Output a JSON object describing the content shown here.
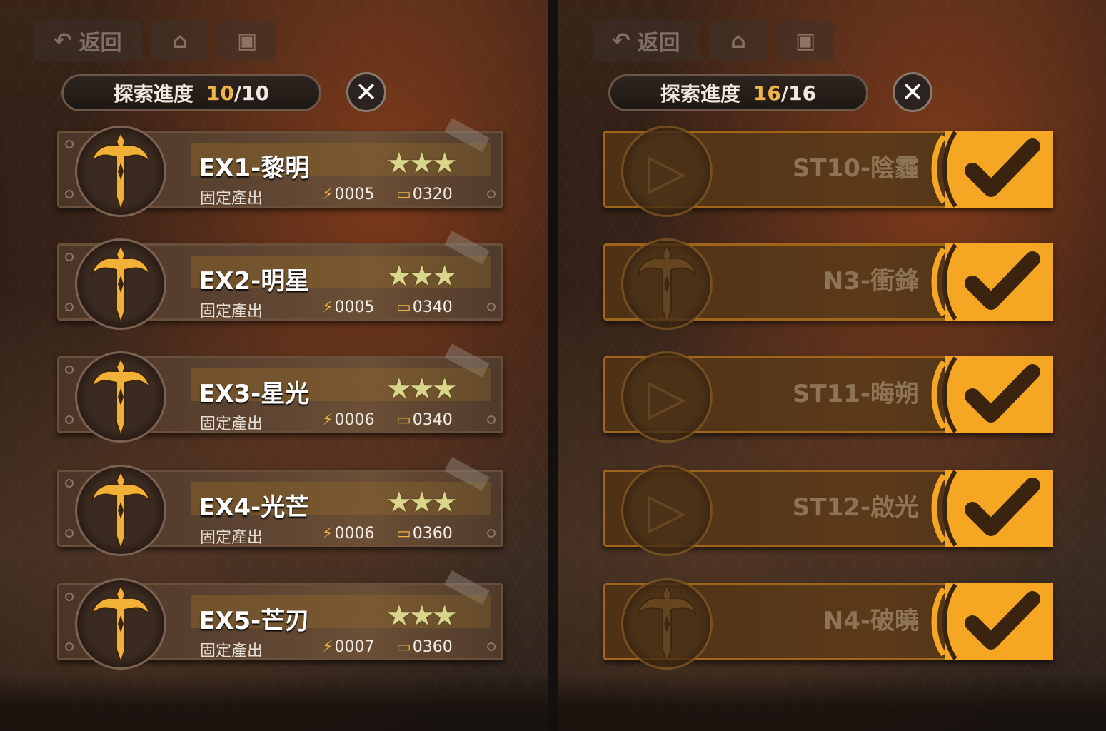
{
  "left": {
    "nav": {
      "back_label": "返回",
      "back_icon": "back-arrow-icon",
      "home_icon": "home-icon",
      "image_icon": "image-icon"
    },
    "progress": {
      "label": "探索進度",
      "current": "10",
      "total": "/10"
    },
    "close_label": "✕",
    "stages": [
      {
        "title": "EX1-黎明",
        "sub": "固定產出",
        "res_a": "0005",
        "res_b": "0320",
        "stars": "★★★"
      },
      {
        "title": "EX2-明星",
        "sub": "固定產出",
        "res_a": "0005",
        "res_b": "0340",
        "stars": "★★★"
      },
      {
        "title": "EX3-星光",
        "sub": "固定產出",
        "res_a": "0006",
        "res_b": "0340",
        "stars": "★★★"
      },
      {
        "title": "EX4-光芒",
        "sub": "固定產出",
        "res_a": "0006",
        "res_b": "0360",
        "stars": "★★★"
      },
      {
        "title": "EX5-芒刃",
        "sub": "固定產出",
        "res_a": "0007",
        "res_b": "0360",
        "stars": "★★★"
      }
    ]
  },
  "right": {
    "nav": {
      "back_label": "返回",
      "back_icon": "back-arrow-icon",
      "home_icon": "home-icon",
      "image_icon": "image-icon"
    },
    "progress": {
      "label": "探索進度",
      "current": "16",
      "total": "/16"
    },
    "close_label": "✕",
    "stages": [
      {
        "title": "ST10-陰霾",
        "icon": "play-icon",
        "completed": true
      },
      {
        "title": "N3-衝鋒",
        "icon": "sword-icon",
        "completed": true
      },
      {
        "title": "ST11-晦朔",
        "icon": "play-icon",
        "completed": true
      },
      {
        "title": "ST12-啟光",
        "icon": "play-icon",
        "completed": true
      },
      {
        "title": "N4-破曉",
        "icon": "sword-icon",
        "completed": true
      }
    ]
  },
  "colors": {
    "accent": "#f1b44a",
    "check": "#f5a623"
  }
}
